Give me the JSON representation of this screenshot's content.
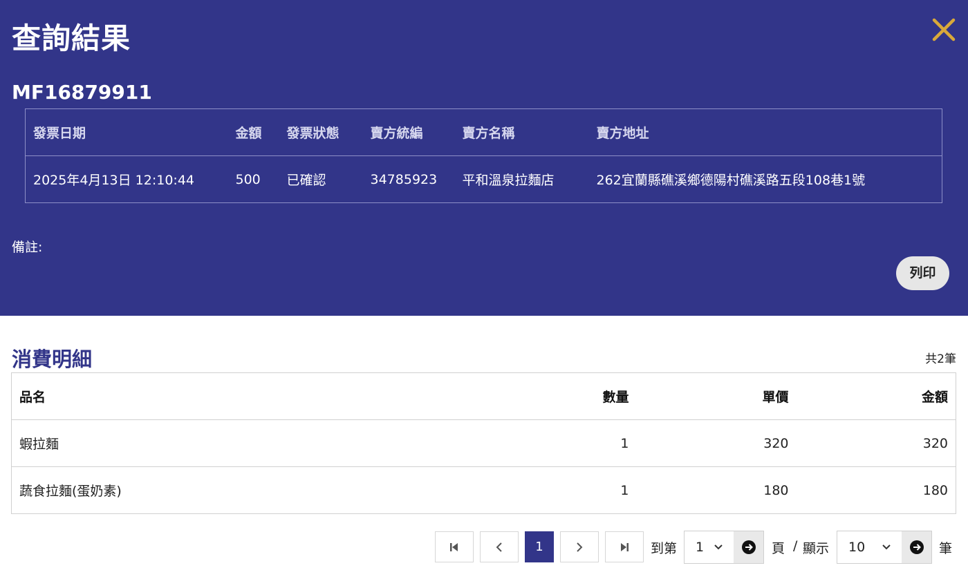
{
  "header": {
    "title": "查詢結果",
    "invoice_number": "MF16879911"
  },
  "invoice_table": {
    "headers": [
      "發票日期",
      "金額",
      "發票狀態",
      "賣方統編",
      "賣方名稱",
      "賣方地址"
    ],
    "row": [
      "2025年4月13日 12:10:44",
      "500",
      "已確認",
      "34785923",
      "平和溫泉拉麵店",
      "262宜蘭縣礁溪鄉德陽村礁溪路五段108巷1號"
    ]
  },
  "note_label": "備註:",
  "print_label": "列印",
  "details": {
    "title": "消費明細",
    "count_text": "共2筆",
    "headers": [
      "品名",
      "數量",
      "單價",
      "金額"
    ],
    "rows": [
      [
        "蝦拉麵",
        "1",
        "320",
        "320"
      ],
      [
        "蔬食拉麵(蛋奶素)",
        "1",
        "180",
        "180"
      ]
    ]
  },
  "pagination": {
    "current_page": "1",
    "goto_label": "到第",
    "page_select_value": "1",
    "page_label": "頁",
    "separator": "/",
    "show_label": "顯示",
    "size_select_value": "10",
    "unit_label": "筆"
  },
  "colors": {
    "primary": "#323589",
    "close_icon": "#d9a93a"
  },
  "icons": [
    "close-icon",
    "first-page-icon",
    "prev-page-icon",
    "next-page-icon",
    "last-page-icon",
    "chevron-down-icon",
    "arrow-right-circle-icon"
  ]
}
